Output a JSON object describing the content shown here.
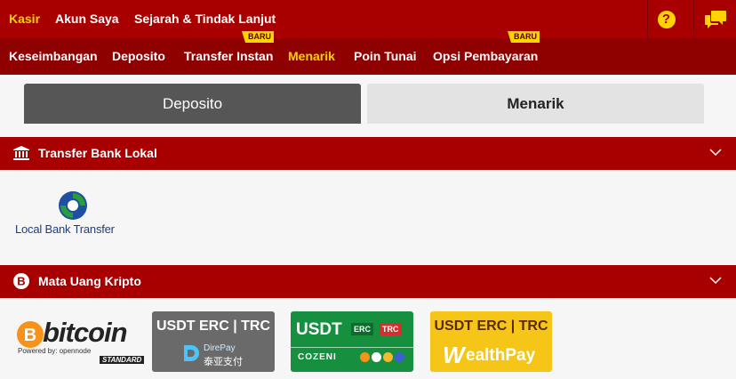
{
  "top_nav": {
    "items": [
      {
        "label": "Kasir",
        "active": true
      },
      {
        "label": "Akun Saya",
        "active": false
      },
      {
        "label": "Sejarah & Tindak Lanjut",
        "active": false
      }
    ],
    "help_icon": "help-icon",
    "chat_icon": "chat-icon"
  },
  "sub_nav": {
    "items": [
      {
        "label": "Keseimbangan",
        "active": false
      },
      {
        "label": "Deposito",
        "active": false
      },
      {
        "label": "Transfer Instan",
        "active": false,
        "badge": "BARU"
      },
      {
        "label": "Menarik",
        "active": true
      },
      {
        "label": "Poin Tunai",
        "active": false
      },
      {
        "label": "Opsi Pembayaran",
        "active": false,
        "badge": "BARU"
      }
    ]
  },
  "tabs": [
    {
      "label": "Deposito",
      "selected": true
    },
    {
      "label": "Menarik",
      "selected": false
    }
  ],
  "sections": [
    {
      "title": "Transfer Bank Lokal",
      "icon": "bank-icon",
      "methods": [
        {
          "name": "Local Bank Transfer"
        }
      ]
    },
    {
      "title": "Mata Uang Kripto",
      "icon": "bitcoin-icon",
      "methods": [
        {
          "name": "bitcoin",
          "sub": "Powered by: opennode",
          "tag": "STANDARD"
        },
        {
          "name": "USDT ERC | TRC",
          "provider": "DirePay",
          "provider_cn": "泰亚支付"
        },
        {
          "name": "USDT",
          "chips": [
            "ERC",
            "TRC"
          ],
          "provider": "COZENI"
        },
        {
          "name": "USDT ERC | TRC",
          "provider": "WealthPay",
          "provider_w": "W",
          "provider_rest": "ealthPay"
        }
      ]
    }
  ],
  "colors": {
    "primary_red": "#a80000",
    "sub_nav_red": "#8f0000",
    "accent_yellow": "#ffd400",
    "tab_active": "#565656",
    "tab_inactive": "#e3e3e3",
    "direpay_gray": "#6a6a6a",
    "cozeni_green": "#16903f",
    "wealthpay_yellow": "#f5c518"
  }
}
